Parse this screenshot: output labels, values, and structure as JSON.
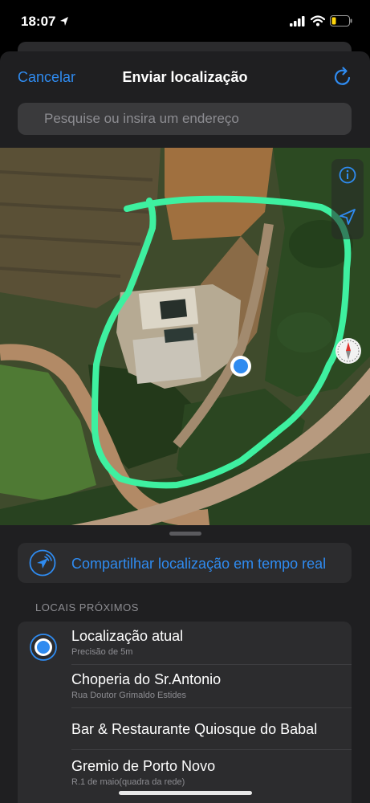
{
  "status_bar": {
    "time": "18:07"
  },
  "nav": {
    "cancel_label": "Cancelar",
    "title": "Enviar localização"
  },
  "search": {
    "placeholder": "Pesquise ou insira um endereço"
  },
  "live_share": {
    "label": "Compartilhar localização em tempo real"
  },
  "nearby": {
    "header": "LOCAIS PRÓXIMOS",
    "items": [
      {
        "name": "Localização atual",
        "detail": "Precisão de 5m"
      },
      {
        "name": "Choperia do Sr.Antonio",
        "detail": "Rua Doutor Grimaldo Estides"
      },
      {
        "name": "Bar & Restaurante Quiosque do Babal",
        "detail": ""
      },
      {
        "name": "Gremio de Porto Novo",
        "detail": "R.1 de maio(quadra da rede)"
      }
    ]
  },
  "colors": {
    "accent": "#2f8bf0",
    "highlight_stroke": "#3ef0a0",
    "sheet_bg": "#1f1f21"
  },
  "icons": [
    "location-arrow-icon",
    "signal-icon",
    "wifi-icon",
    "battery-icon",
    "refresh-icon",
    "info-icon",
    "location-icon",
    "compass-icon",
    "live-location-icon",
    "current-location-icon"
  ]
}
